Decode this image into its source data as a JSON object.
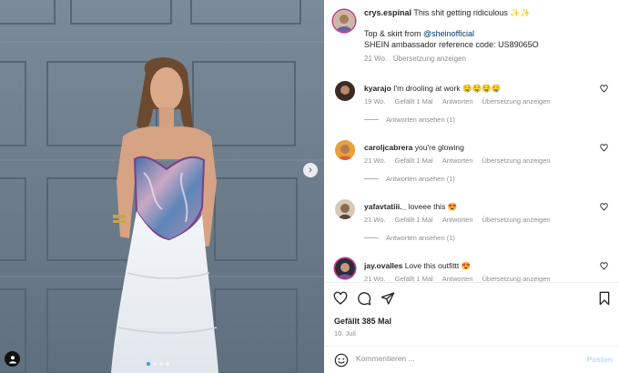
{
  "post": {
    "username": "crys.espinal",
    "caption_text": "This shit getting ridiculous ✨✨",
    "caption_line2_prefix": "Top & skirt from ",
    "caption_mention": "@sheinofficial",
    "caption_line3": "SHEIN ambassador reference code: US89065O",
    "time": "21 Wo.",
    "see_translation": "Übersetzung anzeigen"
  },
  "comments": [
    {
      "username": "kyarajo",
      "text": "I'm drooling at work 🤤🤤🤤🤤",
      "time": "19 Wo.",
      "likes": "Gefällt 1 Mal",
      "reply": "Antworten",
      "translate": "Übersetzung anzeigen",
      "view_replies": "Antworten ansehen (1)"
    },
    {
      "username": "caroljcabrera",
      "text": "you're glowing",
      "time": "21 Wo.",
      "likes": "Gefällt 1 Mal",
      "reply": "Antworten",
      "translate": "Übersetzung anzeigen",
      "view_replies": "Antworten ansehen (1)"
    },
    {
      "username": "yafavtatiii._",
      "text": "loveee this 😍",
      "time": "21 Wo.",
      "likes": "Gefällt 1 Mal",
      "reply": "Antworten",
      "translate": "Übersetzung anzeigen",
      "view_replies": "Antworten ansehen (1)"
    },
    {
      "username": "jay.ovalles",
      "text": "Love this outfittt 😍",
      "time": "21 Wo.",
      "likes": "Gefällt 1 Mal",
      "reply": "Antworten",
      "translate": "Übersetzung anzeigen"
    }
  ],
  "footer": {
    "likes": "Gefällt 385 Mal",
    "date": "10. Juli",
    "comment_placeholder": "Kommentieren ...",
    "post_label": "Posten"
  },
  "carousel": {
    "next_glyph": "›"
  },
  "icons": [
    "heart-icon",
    "comment-icon",
    "share-icon",
    "bookmark-icon",
    "emoji-icon",
    "user-tag-icon",
    "chevron-right-icon"
  ],
  "colors": {
    "accent": "#0095f6",
    "post_disabled": "#b2dffc",
    "muted": "#8e8e8e",
    "garage": "#6f7f8e"
  }
}
